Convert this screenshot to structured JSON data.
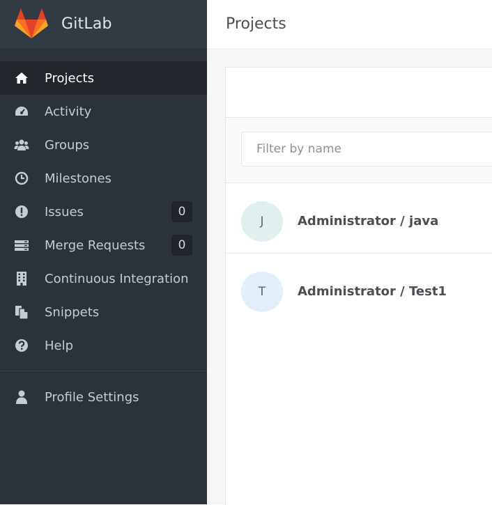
{
  "app": {
    "brand": "GitLab"
  },
  "sidebar": {
    "items": [
      {
        "label": "Projects",
        "icon": "home-icon",
        "active": true
      },
      {
        "label": "Activity",
        "icon": "dashboard-icon"
      },
      {
        "label": "Groups",
        "icon": "users-icon"
      },
      {
        "label": "Milestones",
        "icon": "clock-icon"
      },
      {
        "label": "Issues",
        "icon": "exclamation-circle-icon",
        "count": "0"
      },
      {
        "label": "Merge Requests",
        "icon": "server-icon",
        "count": "0"
      },
      {
        "label": "Continuous Integration",
        "icon": "building-icon"
      },
      {
        "label": "Snippets",
        "icon": "copy-icon"
      },
      {
        "label": "Help",
        "icon": "question-circle-icon"
      }
    ],
    "profile": {
      "label": "Profile Settings",
      "icon": "user-icon"
    }
  },
  "header": {
    "title": "Projects"
  },
  "filter": {
    "placeholder": "Filter by name",
    "value": ""
  },
  "projects": [
    {
      "initial": "J",
      "name": "Administrator / java",
      "avatar_color": "#e0f0ef"
    },
    {
      "initial": "T",
      "name": "Administrator / Test1",
      "avatar_color": "#e2eefa"
    }
  ],
  "colors": {
    "sidebar_bg": "#2b323a",
    "brand_bg": "#323a43",
    "active_bg": "#20262c",
    "logo_orange": "#fc6d26",
    "logo_red": "#e24329",
    "logo_light": "#fca326"
  }
}
